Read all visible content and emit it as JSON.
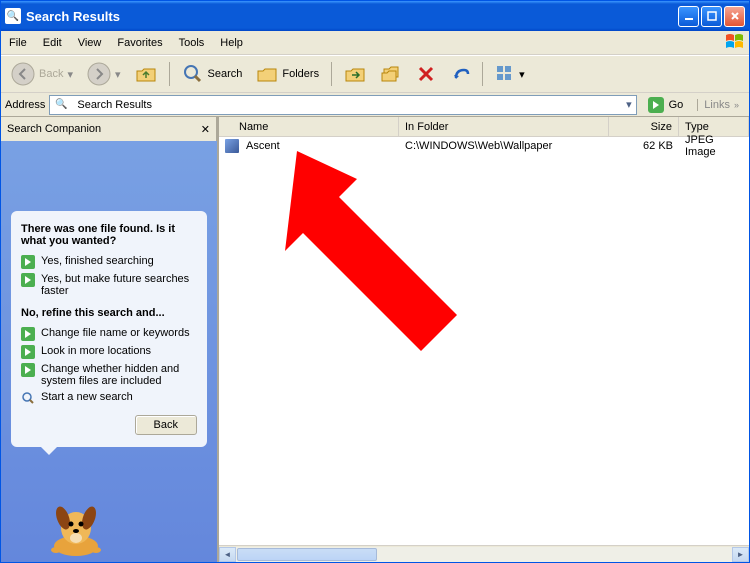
{
  "titlebar": {
    "title": "Search Results"
  },
  "menu": {
    "file": "File",
    "edit": "Edit",
    "view": "View",
    "favorites": "Favorites",
    "tools": "Tools",
    "help": "Help"
  },
  "toolbar": {
    "back": "Back",
    "search": "Search",
    "folders": "Folders"
  },
  "address": {
    "label": "Address",
    "value": "Search Results",
    "go": "Go",
    "links": "Links"
  },
  "sidebar": {
    "header": "Search Companion",
    "heading1": "There was one file found.  Is it what you wanted?",
    "link_yes_finished": "Yes, finished searching",
    "link_yes_faster": "Yes, but make future searches faster",
    "heading2": "No, refine this search and...",
    "link_change_name": "Change file name or keywords",
    "link_more_locations": "Look in more locations",
    "link_hidden": "Change whether hidden and system files are included",
    "link_new_search": "Start a new search",
    "back_btn": "Back"
  },
  "columns": {
    "name": "Name",
    "in_folder": "In Folder",
    "size": "Size",
    "type": "Type"
  },
  "results": [
    {
      "name": "Ascent",
      "folder": "C:\\WINDOWS\\Web\\Wallpaper",
      "size": "62 KB",
      "type": "JPEG Image",
      "selected": true
    }
  ],
  "col_widths": {
    "name": 180,
    "folder": 210,
    "size": 70,
    "type": 120
  }
}
